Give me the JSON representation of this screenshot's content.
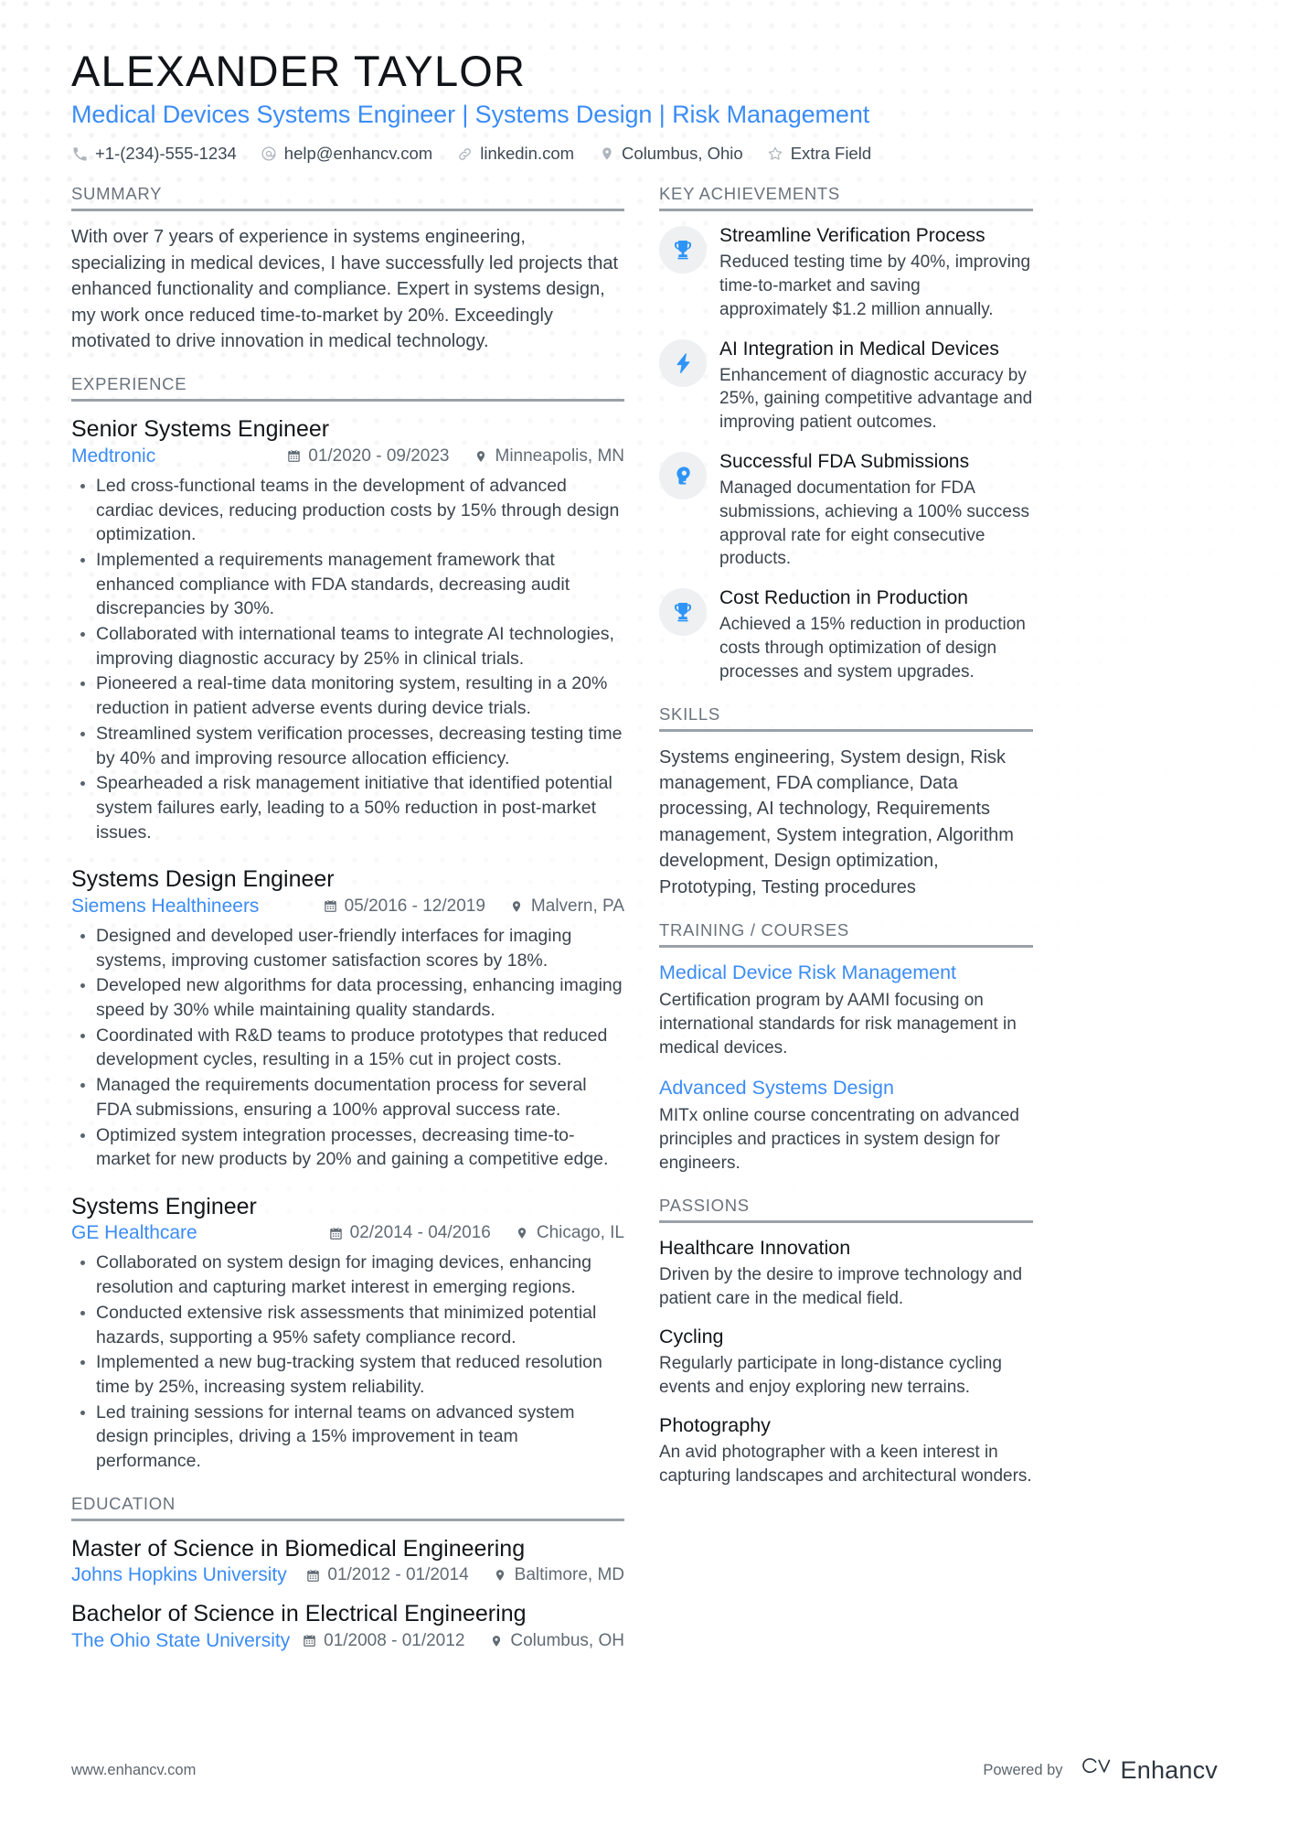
{
  "header": {
    "name": "ALEXANDER TAYLOR",
    "headline": "Medical Devices Systems Engineer | Systems Design | Risk Management",
    "accent_color": "#3b8cf5",
    "contacts": [
      {
        "icon": "phone-icon",
        "text": "+1-(234)-555-1234"
      },
      {
        "icon": "email-icon",
        "text": "help@enhancv.com"
      },
      {
        "icon": "link-icon",
        "text": "linkedin.com"
      },
      {
        "icon": "location-icon",
        "text": "Columbus, Ohio"
      },
      {
        "icon": "star-icon",
        "text": "Extra Field"
      }
    ]
  },
  "summary": {
    "title": "SUMMARY",
    "text": "With over 7 years of experience in systems engineering, specializing in medical devices, I have successfully led projects that enhanced functionality and compliance. Expert in systems design, my work once reduced time-to-market by 20%. Exceedingly motivated to drive innovation in medical technology."
  },
  "experience": {
    "title": "EXPERIENCE",
    "jobs": [
      {
        "title": "Senior Systems Engineer",
        "company": "Medtronic",
        "date": "01/2020 - 09/2023",
        "location": "Minneapolis, MN",
        "bullets": [
          "Led cross-functional teams in the development of advanced cardiac devices, reducing production costs by 15% through design optimization.",
          "Implemented a requirements management framework that enhanced compliance with FDA standards, decreasing audit discrepancies by 30%.",
          "Collaborated with international teams to integrate AI technologies, improving diagnostic accuracy by 25% in clinical trials.",
          "Pioneered a real-time data monitoring system, resulting in a 20% reduction in patient adverse events during device trials.",
          "Streamlined system verification processes, decreasing testing time by 40% and improving resource allocation efficiency.",
          "Spearheaded a risk management initiative that identified potential system failures early, leading to a 50% reduction in post-market issues."
        ]
      },
      {
        "title": "Systems Design Engineer",
        "company": "Siemens Healthineers",
        "date": "05/2016 - 12/2019",
        "location": "Malvern, PA",
        "bullets": [
          "Designed and developed user-friendly interfaces for imaging systems, improving customer satisfaction scores by 18%.",
          "Developed new algorithms for data processing, enhancing imaging speed by 30% while maintaining quality standards.",
          "Coordinated with R&D teams to produce prototypes that reduced development cycles, resulting in a 15% cut in project costs.",
          "Managed the requirements documentation process for several FDA submissions, ensuring a 100% approval success rate.",
          "Optimized system integration processes, decreasing time-to-market for new products by 20% and gaining a competitive edge."
        ]
      },
      {
        "title": "Systems Engineer",
        "company": "GE Healthcare",
        "date": "02/2014 - 04/2016",
        "location": "Chicago, IL",
        "bullets": [
          "Collaborated on system design for imaging devices, enhancing resolution and capturing market interest in emerging regions.",
          "Conducted extensive risk assessments that minimized potential hazards, supporting a 95% safety compliance record.",
          "Implemented a new bug-tracking system that reduced resolution time by 25%, increasing system reliability.",
          "Led training sessions for internal teams on advanced system design principles, driving a 15% improvement in team performance."
        ]
      }
    ]
  },
  "education": {
    "title": "EDUCATION",
    "entries": [
      {
        "degree": "Master of Science in Biomedical Engineering",
        "school": "Johns Hopkins University",
        "date": "01/2012 - 01/2014",
        "location": "Baltimore, MD"
      },
      {
        "degree": "Bachelor of Science in Electrical Engineering",
        "school": "The Ohio State University",
        "date": "01/2008 - 01/2012",
        "location": "Columbus, OH"
      }
    ]
  },
  "achievements": {
    "title": "KEY ACHIEVEMENTS",
    "items": [
      {
        "icon": "trophy-icon",
        "title": "Streamline Verification Process",
        "desc": "Reduced testing time by 40%, improving time-to-market and saving approximately $1.2 million annually."
      },
      {
        "icon": "lightning-bolt-icon",
        "title": "AI Integration in Medical Devices",
        "desc": "Enhancement of diagnostic accuracy by 25%, gaining competitive advantage and improving patient outcomes."
      },
      {
        "icon": "head-profile-icon",
        "title": "Successful FDA Submissions",
        "desc": "Managed documentation for FDA submissions, achieving a 100% success approval rate for eight consecutive products."
      },
      {
        "icon": "trophy-icon",
        "title": "Cost Reduction in Production",
        "desc": "Achieved a 15% reduction in production costs through optimization of design processes and system upgrades."
      }
    ]
  },
  "skills": {
    "title": "SKILLS",
    "text": "Systems engineering, System design, Risk management, FDA compliance, Data processing, AI technology, Requirements management, System integration, Algorithm development, Design optimization, Prototyping, Testing procedures"
  },
  "training": {
    "title": "TRAINING / COURSES",
    "courses": [
      {
        "title": "Medical Device Risk Management",
        "desc": "Certification program by AAMI focusing on international standards for risk management in medical devices."
      },
      {
        "title": "Advanced Systems Design",
        "desc": "MITx online course concentrating on advanced principles and practices in system design for engineers."
      }
    ]
  },
  "passions": {
    "title": "PASSIONS",
    "items": [
      {
        "title": "Healthcare Innovation",
        "desc": "Driven by the desire to improve technology and patient care in the medical field."
      },
      {
        "title": "Cycling",
        "desc": "Regularly participate in long-distance cycling events and enjoy exploring new terrains."
      },
      {
        "title": "Photography",
        "desc": "An avid photographer with a keen interest in capturing landscapes and architectural wonders."
      }
    ]
  },
  "footer": {
    "url": "www.enhancv.com",
    "powered_by": "Powered by",
    "brand": "Enhancv"
  }
}
